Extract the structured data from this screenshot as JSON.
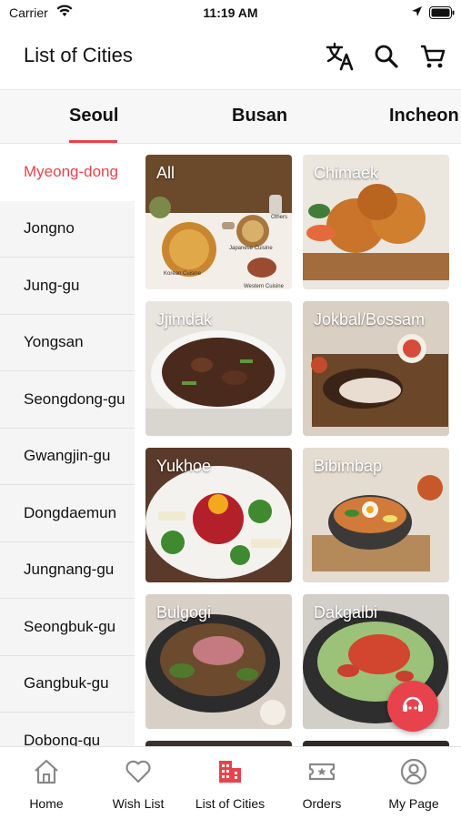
{
  "status_bar": {
    "carrier": "Carrier",
    "time": "11:19 AM"
  },
  "header": {
    "title": "List of Cities",
    "icons": [
      "translate-icon",
      "search-icon",
      "cart-icon"
    ]
  },
  "city_tabs": {
    "items": [
      "Seoul",
      "Busan",
      "Incheon"
    ],
    "selected": "Seoul"
  },
  "districts": {
    "selected": "Myeong-dong",
    "items": [
      "Myeong-dong",
      "Jongno",
      "Jung-gu",
      "Yongsan",
      "Seongdong-gu",
      "Gwangjin-gu",
      "Dongdaemun",
      "Jungnang-gu",
      "Seongbuk-gu",
      "Gangbuk-gu",
      "Dobong-gu"
    ]
  },
  "food_categories": {
    "items": [
      {
        "label": "All",
        "sub_labels": [
          "Others",
          "Japanese Cuisine",
          "Korean Cuisine",
          "Western Cuisine"
        ]
      },
      {
        "label": "Chimaek"
      },
      {
        "label": "Jjimdak"
      },
      {
        "label": "Jokbal/Bossam"
      },
      {
        "label": "Yukhoe"
      },
      {
        "label": "Bibimbap"
      },
      {
        "label": "Bulgogi"
      },
      {
        "label": "Dakgalbi"
      }
    ]
  },
  "tab_bar": {
    "items": [
      {
        "label": "Home",
        "icon": "home-icon"
      },
      {
        "label": "Wish List",
        "icon": "heart-icon"
      },
      {
        "label": "List of Cities",
        "icon": "city-icon"
      },
      {
        "label": "Orders",
        "icon": "ticket-icon"
      },
      {
        "label": "My Page",
        "icon": "user-icon"
      }
    ],
    "selected": "List of Cities"
  },
  "colors": {
    "accent": "#e8434d",
    "sidebar_bg": "#f5f5f5",
    "tabs_bg": "#f7f7f7"
  }
}
